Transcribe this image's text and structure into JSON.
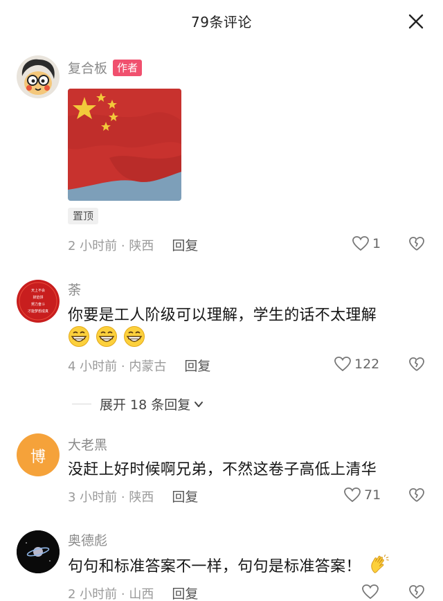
{
  "header": {
    "title": "79条评论"
  },
  "comments": [
    {
      "username": "复合板",
      "badge": "作者",
      "pinned": "置顶",
      "time": "2 小时前 · 陕西",
      "reply": "回复",
      "likes": "1"
    },
    {
      "username": "荼",
      "avatar_text": [
        "天上不会",
        "掉馅饼",
        "努力奋斗",
        "才能梦想成真"
      ],
      "text": "你要是工人阶级可以理解，学生的话不太理解",
      "time": "4 小时前 · 内蒙古",
      "reply": "回复",
      "likes": "122"
    },
    {
      "username": "大老黑",
      "avatar_text": "博",
      "text": "没赶上好时候啊兄弟，不然这卷子高低上清华",
      "time": "3 小时前 · 陕西",
      "reply": "回复",
      "likes": "71"
    },
    {
      "username": "奥德彪",
      "text": "句句和标准答案不一样，句句是标准答案！",
      "time": "2 小时前 · 山西",
      "reply": "回复"
    }
  ],
  "expand_replies": "展开 18 条回复",
  "colors": {
    "badge": "#f0506e",
    "flag_red": "#c8322e",
    "flag_star": "#f2c93b",
    "avatar_orange": "#f5a23a"
  }
}
